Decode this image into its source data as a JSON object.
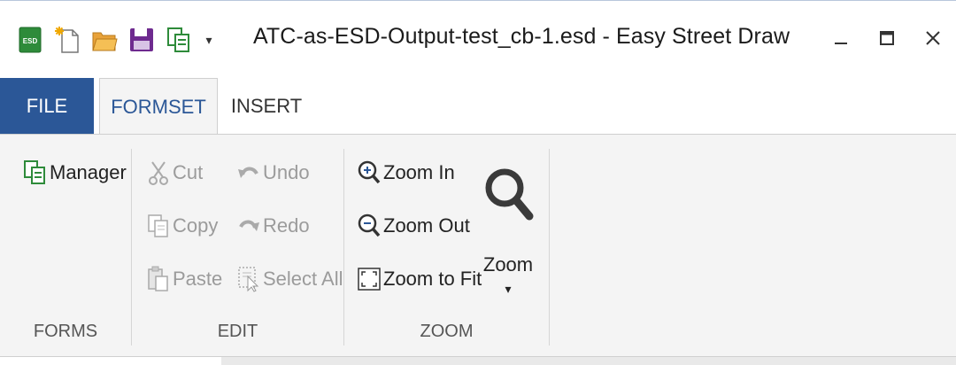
{
  "titlebar": {
    "app_icon": "ESD",
    "title": "ATC-as-ESD-Output-test_cb-1.esd - Easy Street Draw",
    "qat_more": "▾",
    "icons": [
      "esd-logo-icon",
      "new-file-icon",
      "open-folder-icon",
      "save-icon",
      "manager-icon"
    ]
  },
  "window": {
    "minimize": "–",
    "maximize": "☐",
    "close": "✕"
  },
  "tabs": {
    "file": "FILE",
    "formset": "FORMSET",
    "insert": "INSERT"
  },
  "ribbon": {
    "forms": {
      "label": "FORMS",
      "manager": "Manager"
    },
    "edit": {
      "label": "EDIT",
      "cut": "Cut",
      "copy": "Copy",
      "paste": "Paste",
      "undo": "Undo",
      "redo": "Redo",
      "select_all": "Select All"
    },
    "zoom": {
      "label": "ZOOM",
      "zoom_in": "Zoom In",
      "zoom_out": "Zoom Out",
      "zoom_fit": "Zoom to Fit",
      "zoom": "Zoom",
      "zoom_arrow": "▾"
    }
  },
  "colors": {
    "file_tab": "#2b5797",
    "active_tab_text": "#2b5797",
    "ribbon_bg": "#f4f4f4",
    "disabled_text": "#9b9b9b"
  }
}
